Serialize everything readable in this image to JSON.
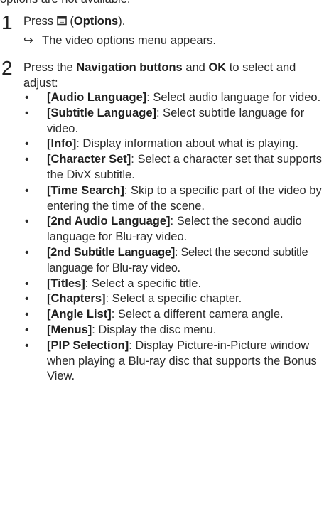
{
  "intro": "options are not available.",
  "step1": {
    "number": "1",
    "press_label": "Press",
    "button_name": "Options",
    "result_arrow": "↪",
    "result_text": "The video options menu appears."
  },
  "step2": {
    "number": "2",
    "press_label": "Press the",
    "nav_buttons": "Navigation buttons",
    "and_label": "and",
    "ok_label": "OK",
    "to_select": "to select and adjust:",
    "bullet_symbol": "•",
    "items": [
      {
        "name": "[Audio Language]",
        "desc": ": Select audio language for video."
      },
      {
        "name": "[Subtitle Language]",
        "desc": ": Select subtitle language for video."
      },
      {
        "name": "[Info]",
        "desc": ": Display information about what is playing."
      },
      {
        "name": "[Character Set]",
        "desc": ": Select a character set that supports the DivX subtitle."
      },
      {
        "name": "[Time Search]",
        "desc": ": Skip to a specific part of the video by entering the time of the scene."
      },
      {
        "name": "[2nd Audio Language]",
        "desc": ": Select the second audio language for Blu-ray video."
      },
      {
        "name": "[2nd Subtitle Language]",
        "desc": ": Select the second subtitle language for Blu-ray video."
      },
      {
        "name": "[Titles]",
        "desc": ": Select a specific title."
      },
      {
        "name": "[Chapters]",
        "desc": ": Select a specific chapter."
      },
      {
        "name": "[Angle List]",
        "desc": ": Select a different camera angle."
      },
      {
        "name": "[Menus]",
        "desc": ": Display the disc menu."
      },
      {
        "name": "[PIP Selection]",
        "desc": ": Display Picture-in-Picture window when playing a Blu-ray disc that supports the Bonus View."
      }
    ]
  }
}
